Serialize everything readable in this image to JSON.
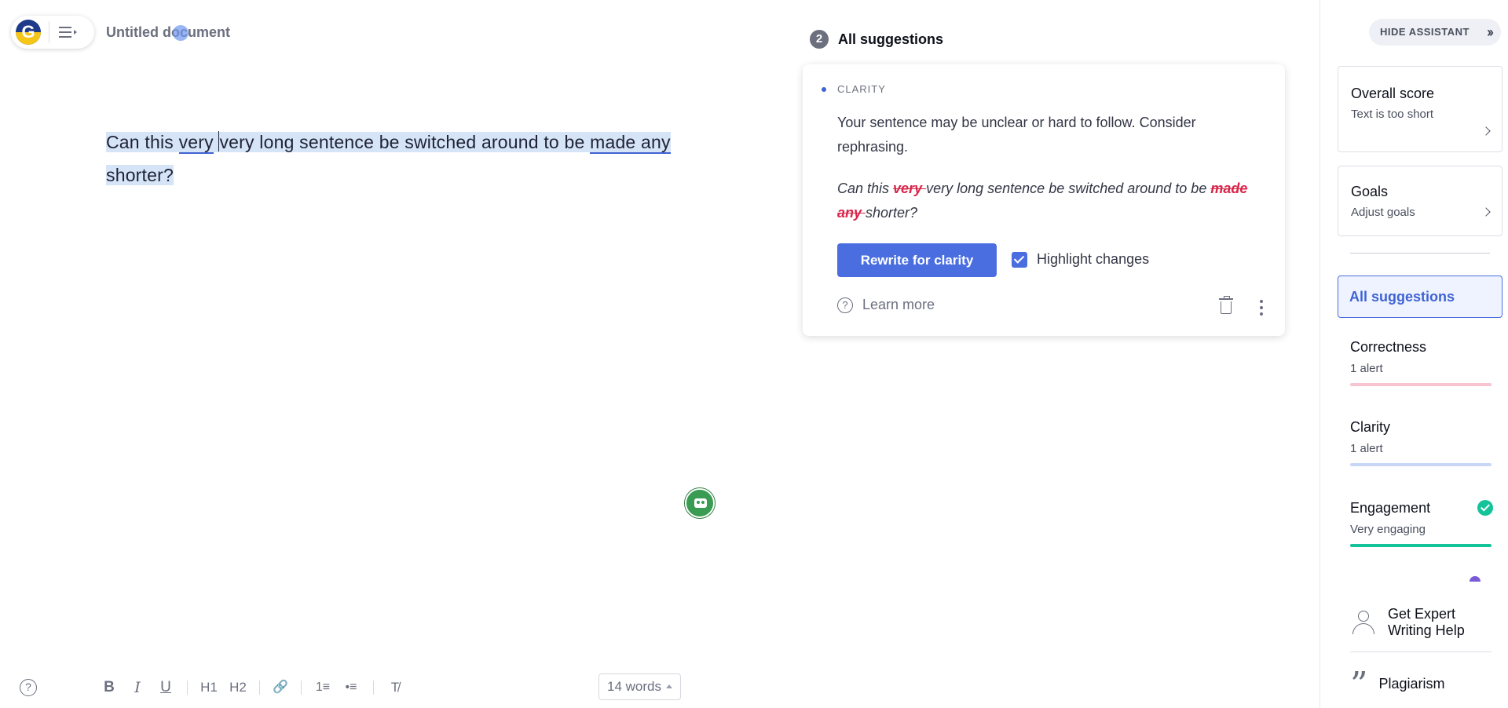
{
  "header": {
    "document_title": "Untitled document"
  },
  "editor": {
    "parts": [
      "Can this ",
      "very",
      " ",
      "very long sentence be switched around to be ",
      "made any",
      " shorter?"
    ]
  },
  "toolbar": {
    "help": "?",
    "bold": "B",
    "italic": "I",
    "underline": "U",
    "h1": "H1",
    "h2": "H2",
    "link": "🔗",
    "ordered_list": "1≡",
    "bullet_list": "•≡",
    "clear_format": "T̸",
    "word_count": "14 words"
  },
  "suggestions": {
    "count": "2",
    "title": "All suggestions",
    "card": {
      "category": "CLARITY",
      "description": "Your sentence may be unclear or hard to follow. Consider rephrasing.",
      "example_1": "Can this ",
      "example_strike_1": "very ",
      "example_2": "very long sentence be switched around to be ",
      "example_strike_2": "made any ",
      "example_3": "shorter?",
      "rewrite_button": "Rewrite for clarity",
      "highlight_label": "Highlight changes",
      "learn_more": "Learn more"
    }
  },
  "sidebar": {
    "hide_assistant": "HIDE ASSISTANT",
    "overall_score": {
      "title": "Overall score",
      "subtitle": "Text is too short"
    },
    "goals": {
      "title": "Goals",
      "subtitle": "Adjust goals"
    },
    "all_suggestions": "All suggestions",
    "categories": [
      {
        "title": "Correctness",
        "subtitle": "1 alert",
        "color": "#f7c4cf"
      },
      {
        "title": "Clarity",
        "subtitle": "1 alert",
        "color": "#c9d7f7"
      },
      {
        "title": "Engagement",
        "subtitle": "Very engaging",
        "color": "#15c39a"
      }
    ],
    "expert_help": "Get Expert Writing Help",
    "plagiarism": "Plagiarism"
  },
  "colors": {
    "accent": "#4a6ee0",
    "strike": "#d9254a",
    "success": "#15c39a"
  }
}
